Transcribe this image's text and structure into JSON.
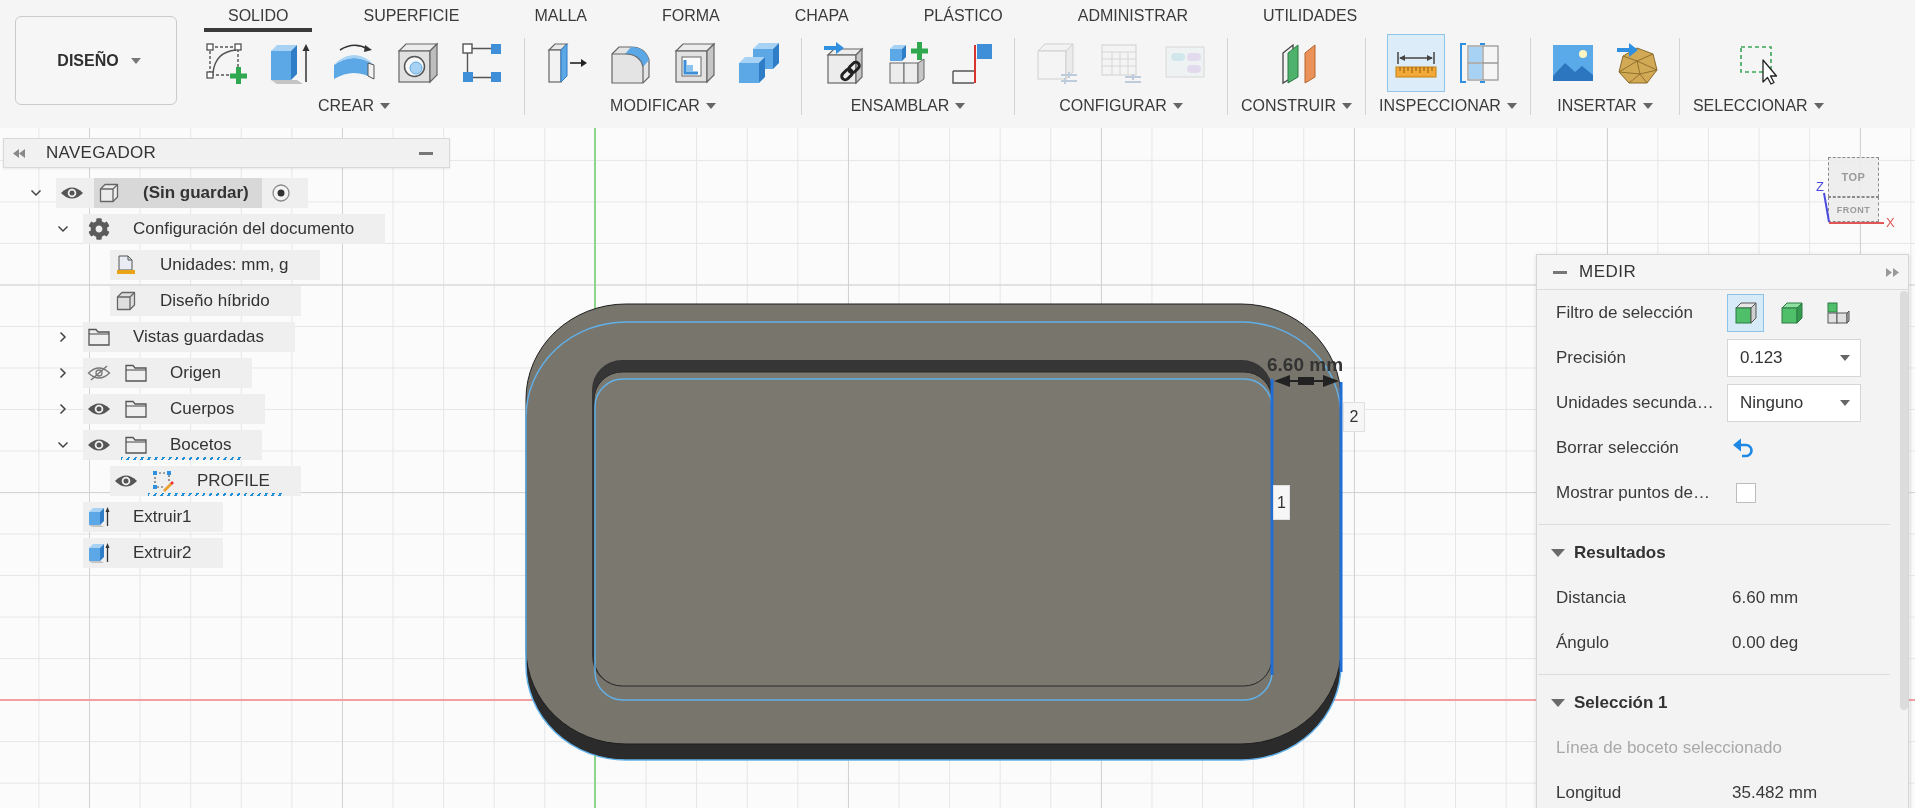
{
  "toolbar": {
    "workspace": {
      "label": "DISEÑO"
    },
    "tabs": [
      {
        "label": "SOLIDO",
        "selected": true
      },
      {
        "label": "SUPERFICIE",
        "selected": false
      },
      {
        "label": "MALLA",
        "selected": false
      },
      {
        "label": "FORMA",
        "selected": false
      },
      {
        "label": "CHAPA",
        "selected": false
      },
      {
        "label": "PLÁSTICO",
        "selected": false
      },
      {
        "label": "ADMINISTRAR",
        "selected": false
      },
      {
        "label": "UTILIDADES",
        "selected": false
      }
    ],
    "groups": [
      {
        "label": "CREAR",
        "tools": [
          {
            "kind": "sketch",
            "active": false,
            "disabled": false
          },
          {
            "kind": "extrude",
            "active": false,
            "disabled": false
          },
          {
            "kind": "revolve",
            "active": false,
            "disabled": false
          },
          {
            "kind": "hole",
            "active": false,
            "disabled": false
          },
          {
            "kind": "pattern",
            "active": false,
            "disabled": false
          }
        ]
      },
      {
        "label": "MODIFICAR",
        "tools": [
          {
            "kind": "presspull",
            "active": false,
            "disabled": false
          },
          {
            "kind": "fillet",
            "active": false,
            "disabled": false
          },
          {
            "kind": "shell",
            "active": false,
            "disabled": false
          },
          {
            "kind": "combine",
            "active": false,
            "disabled": false
          }
        ]
      },
      {
        "label": "ENSAMBLAR",
        "tools": [
          {
            "kind": "link",
            "active": false,
            "disabled": false
          },
          {
            "kind": "new_component",
            "active": false,
            "disabled": false
          },
          {
            "kind": "joint",
            "active": false,
            "disabled": false
          }
        ]
      },
      {
        "label": "CONFIGURAR",
        "tools": [
          {
            "kind": "configure",
            "active": false,
            "disabled": true
          },
          {
            "kind": "table",
            "active": false,
            "disabled": true
          },
          {
            "kind": "rules",
            "active": false,
            "disabled": true
          }
        ]
      },
      {
        "label": "CONSTRUIR",
        "tools": [
          {
            "kind": "plane",
            "active": false,
            "disabled": false
          }
        ]
      },
      {
        "label": "INSPECCIONAR",
        "tools": [
          {
            "kind": "measure",
            "active": true,
            "disabled": false
          },
          {
            "kind": "section",
            "active": false,
            "disabled": false
          }
        ]
      },
      {
        "label": "INSERTAR",
        "tools": [
          {
            "kind": "image",
            "active": false,
            "disabled": false
          },
          {
            "kind": "mesh",
            "active": false,
            "disabled": false
          }
        ]
      },
      {
        "label": "SELECCIONAR",
        "tools": [
          {
            "kind": "select",
            "active": false,
            "disabled": false
          }
        ]
      }
    ]
  },
  "navigator": {
    "title": "NAVEGADOR",
    "tree": [
      {
        "label": "(Sin guardar)",
        "kind": "component",
        "expanded": true,
        "visible": true,
        "selected": true,
        "highlighted": false,
        "active": true,
        "children": [
          {
            "label": "Configuración del documento",
            "kind": "settings",
            "expanded": true,
            "selected": false,
            "highlighted": false,
            "children": [
              {
                "label": "Unidades: mm, g",
                "kind": "units",
                "selected": false,
                "highlighted": false
              },
              {
                "label": "Diseño híbrido",
                "kind": "design",
                "selected": false,
                "highlighted": false
              }
            ]
          },
          {
            "label": "Vistas guardadas",
            "kind": "folder",
            "expanded": false,
            "selected": false,
            "highlighted": false
          },
          {
            "label": "Origen",
            "kind": "folder",
            "expanded": false,
            "visible": false,
            "selected": false,
            "highlighted": false
          },
          {
            "label": "Cuerpos",
            "kind": "folder",
            "expanded": false,
            "visible": true,
            "selected": false,
            "highlighted": false
          },
          {
            "label": "Bocetos",
            "kind": "folder",
            "expanded": true,
            "visible": true,
            "selected": false,
            "highlighted": true,
            "children": [
              {
                "label": "PROFILE",
                "kind": "sketch",
                "visible": true,
                "selected": false,
                "highlighted": true
              }
            ]
          },
          {
            "label": "Extruir1",
            "kind": "extrude",
            "selected": false,
            "highlighted": false
          },
          {
            "label": "Extruir2",
            "kind": "extrude",
            "selected": false,
            "highlighted": false
          }
        ]
      }
    ]
  },
  "viewport": {
    "view_cube": {
      "top": "TOP",
      "front": "FRONT",
      "axes": [
        "Z",
        "X"
      ]
    },
    "dimension": {
      "label": "6.60 mm"
    },
    "point_tags": [
      {
        "label": "2"
      },
      {
        "label": "1"
      }
    ]
  },
  "measure_panel": {
    "title": "MEDIR",
    "fields": [
      {
        "kind": "filter",
        "label": "Filtro de selección",
        "options": [
          {
            "kind": "face",
            "selected": true
          },
          {
            "kind": "body",
            "selected": false
          },
          {
            "kind": "component",
            "selected": false
          }
        ]
      },
      {
        "kind": "dropdown",
        "label": "Precisión",
        "value": "0.123"
      },
      {
        "kind": "dropdown",
        "label": "Unidades secunda…",
        "value": "Ninguno"
      },
      {
        "kind": "action",
        "label": "Borrar selección"
      },
      {
        "kind": "checkbox",
        "label": "Mostrar puntos de…",
        "checked": false
      }
    ],
    "sections": [
      {
        "title": "Resultados",
        "expanded": true,
        "rows": [
          {
            "label": "Distancia",
            "value": "6.60 mm"
          },
          {
            "label": "Ángulo",
            "value": "0.00 deg"
          }
        ]
      },
      {
        "title": "Selección 1",
        "expanded": true,
        "note": "Línea de boceto seleccionado",
        "rows": [
          {
            "label": "Longitud",
            "value": "35.482 mm"
          }
        ]
      }
    ]
  }
}
